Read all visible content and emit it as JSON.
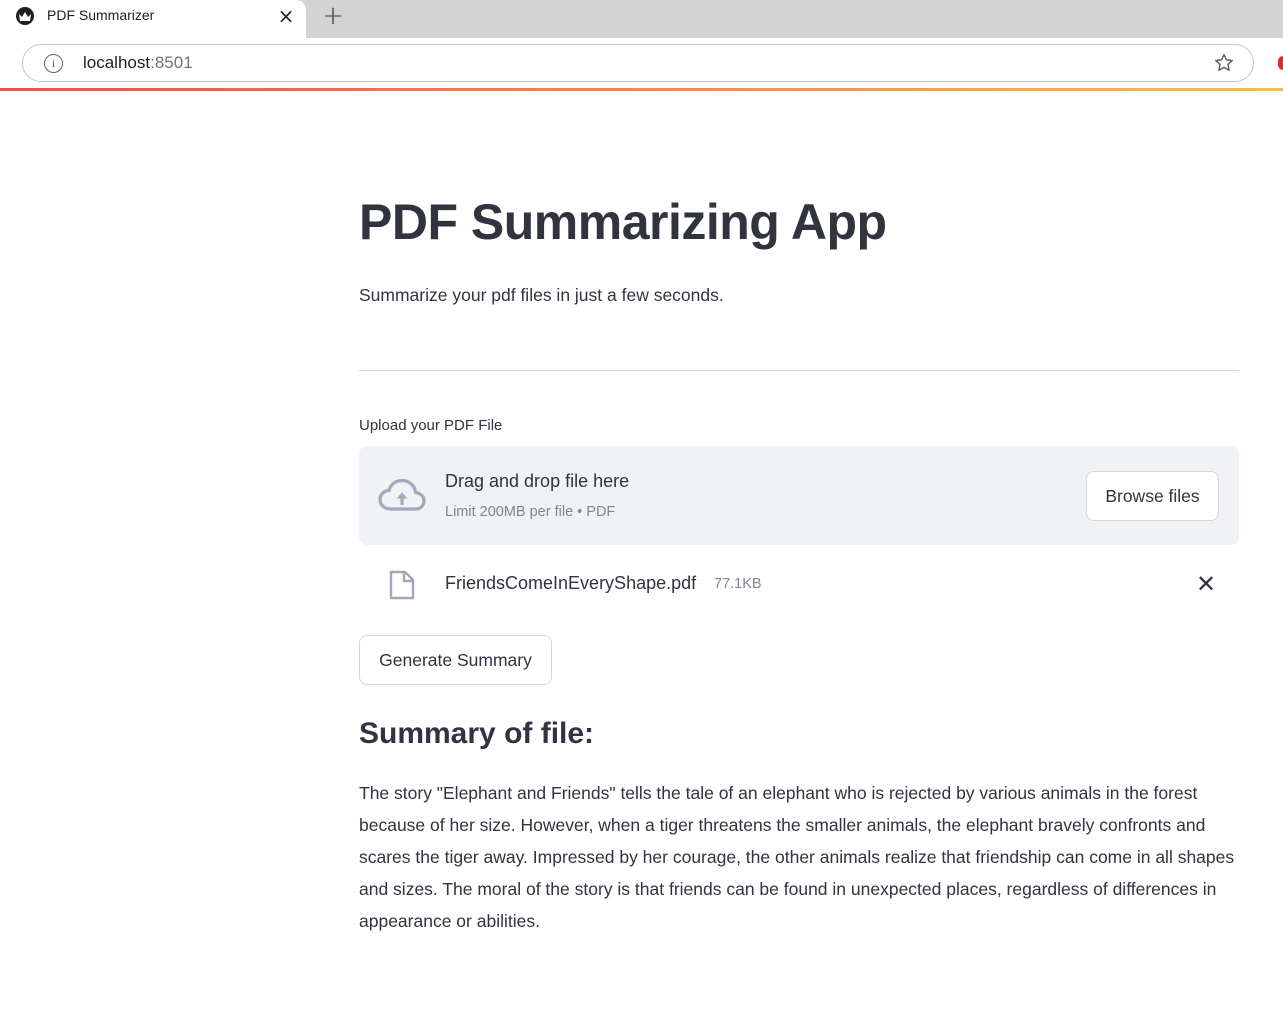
{
  "browser": {
    "tab_title": "PDF Summarizer",
    "tab_close": "×",
    "new_tab": "+",
    "url_host": "localhost",
    "url_port": ":8501"
  },
  "app": {
    "title": "PDF Summarizing App",
    "subtitle": "Summarize your pdf files in just a few seconds.",
    "upload_label": "Upload your PDF File",
    "dropzone": {
      "title": "Drag and drop file here",
      "limit": "Limit 200MB per file • PDF",
      "browse_label": "Browse files"
    },
    "uploaded_file": {
      "name": "FriendsComeInEveryShape.pdf",
      "size": "77.1KB",
      "remove": "✕"
    },
    "generate_label": "Generate Summary",
    "summary_heading": "Summary of file:",
    "summary_text": "The story \"Elephant and Friends\" tells the tale of an elephant who is rejected by various animals in the forest because of her size. However, when a tiger threatens the smaller animals, the elephant bravely confronts and scares the tiger away. Impressed by her courage, the other animals realize that friendship can come in all shapes and sizes. The moral of the story is that friends can be found in unexpected places, regardless of differences in appearance or abilities."
  },
  "colors": {
    "text": "#31333f",
    "muted": "#808495",
    "dropzone_bg": "#f0f2f6",
    "accent_start": "#ff4b4b",
    "accent_end": "#ffbd45"
  },
  "icons": [
    "streamlit-favicon-icon",
    "info-icon",
    "star-icon",
    "cloud-upload-icon",
    "file-icon",
    "close-icon"
  ]
}
